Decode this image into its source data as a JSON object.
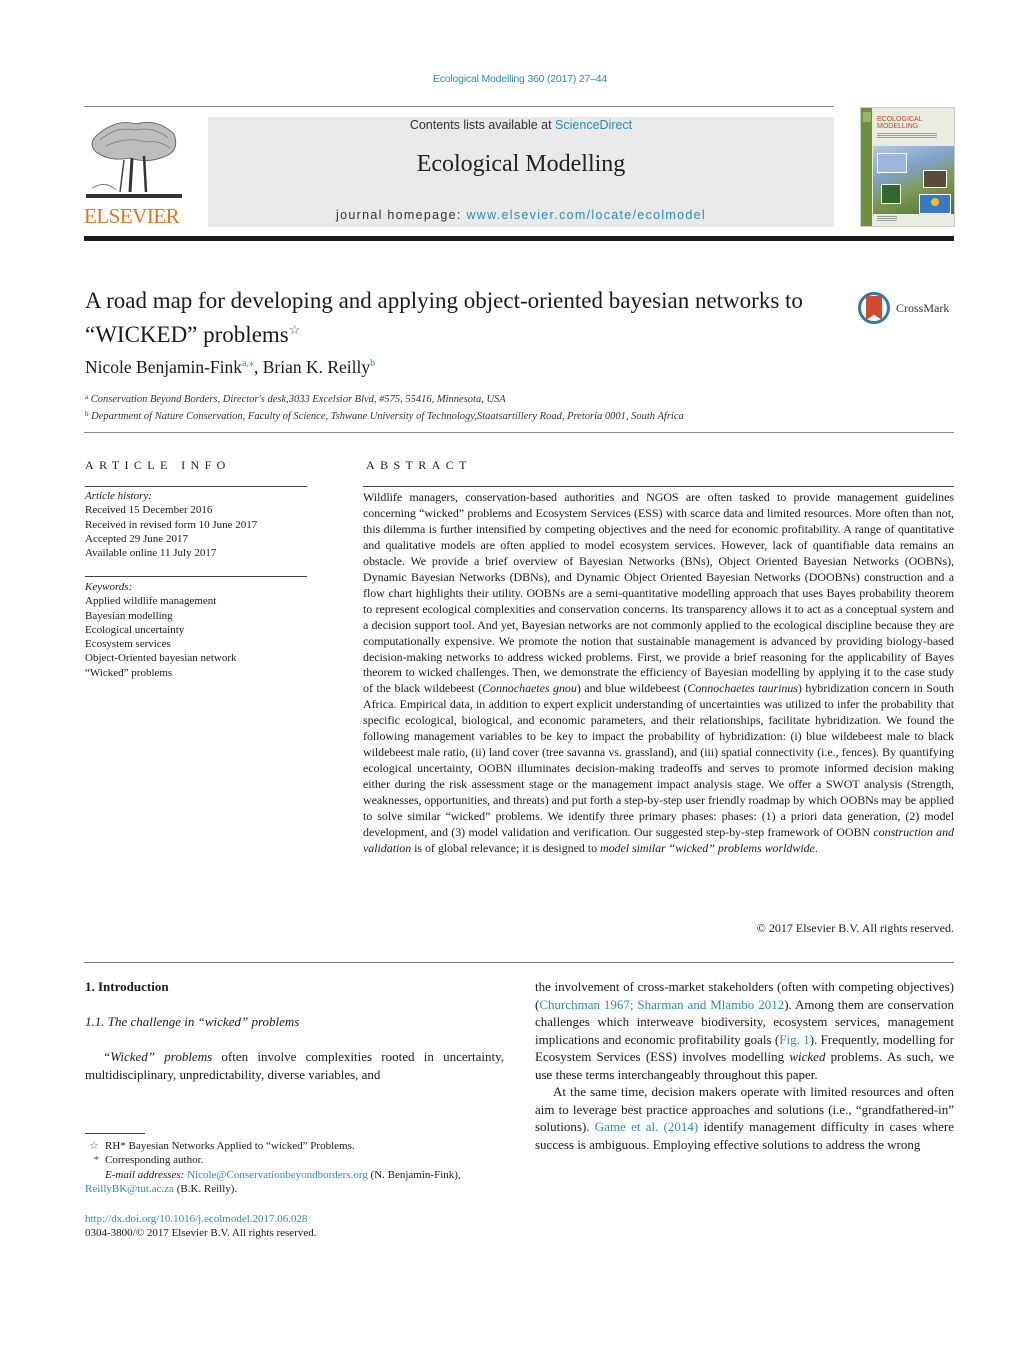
{
  "journal_citation": "Ecological Modelling 360 (2017) 27–44",
  "header": {
    "publisher_wordmark": "ELSEVIER",
    "contents_prefix": "Contents lists available at ",
    "contents_link": "ScienceDirect",
    "journal_name": "Ecological Modelling",
    "homepage_prefix": "journal homepage: ",
    "homepage_link": "www.elsevier.com/locate/ecolmodel",
    "cover": {
      "title_line1": "ECOLOGICAL",
      "title_line2": "MODELLING"
    }
  },
  "article": {
    "title": "A road map for developing and applying object-oriented bayesian networks to “WICKED” problems",
    "title_mark": "☆",
    "crossmark_label": "CrossMark",
    "authors": [
      {
        "name": "Nicole Benjamin-Fink",
        "sup": "a,⁎"
      },
      {
        "name": "Brian K. Reilly",
        "sup": "b"
      }
    ],
    "author_separator": ", ",
    "affiliations": [
      {
        "mark": "a",
        "text": "Conservation Beyond Borders, Director's desk,3033 Excelsior Blvd, #575, 55416, Minnesota, USA"
      },
      {
        "mark": "b",
        "text": "Department of Nature Conservation, Faculty of Science, Tshwane University of Technology,Staatsartillery Road, Pretoria 0001, South Africa"
      }
    ]
  },
  "article_info": {
    "heading": "ARTICLE INFO",
    "history_label": "Article history:",
    "history": [
      "Received 15 December 2016",
      "Received in revised form 10 June 2017",
      "Accepted 29 June 2017",
      "Available online 11 July 2017"
    ],
    "keywords_label": "Keywords:",
    "keywords": [
      "Applied wildlife management",
      "Bayesian modelling",
      "Ecological uncertainty",
      "Ecosystem services",
      "Object-Oriented bayesian network",
      "“Wicked” problems"
    ]
  },
  "abstract": {
    "heading": "ABSTRACT",
    "part1": "Wildlife managers, conservation-based authorities and NGOS are often tasked to provide management guidelines concerning “wicked” problems and Ecosystem Services (ESS) with scarce data and limited resources. More often than not, this dilemma is further intensified by competing objectives and the need for economic profitability. A range of quantitative and qualitative models are often applied to model ecosystem services. However, lack of quantifiable data remains an obstacle. We provide a brief overview of Bayesian Networks (BNs), Object Oriented Bayesian Networks (OOBNs), Dynamic Bayesian Networks (DBNs), and Dynamic Object Oriented Bayesian Networks (DOOBNs) construction and a flow chart highlights their utility. OOBNs are a semi-quantitative modelling approach that uses Bayes probability theorem to represent ecological complexities and conservation concerns. Its transparency allows it to act as a conceptual system and a decision support tool. And yet, Bayesian networks are not commonly applied to the ecological discipline because they are computationally expensive. We promote the notion that sustainable management is advanced by providing biology-based decision-making networks to address wicked problems. First, we provide a brief reasoning for the applicability of Bayes theorem to wicked challenges. Then, we demonstrate the efficiency of Bayesian modelling by applying it to the case study of the black wildebeest (",
    "species1": "Connochaetes gnou",
    "part2": ") and blue wildebeest (",
    "species2": "Connochaetes taurinus",
    "part3": ") hybridization concern in South Africa. Empirical data, in addition to expert explicit understanding of uncertainties was utilized to infer the probability that specific ecological, biological, and economic parameters, and their relationships, facilitate hybridization. We found the following management variables to be key to impact the probability of hybridization: (i) blue wildebeest male to black wildebeest male ratio, (ii) land cover (tree savanna vs. grassland), and (iii) spatial connectivity (i.e., fences). By quantifying ecological uncertainty, OOBN illuminates decision-making tradeoffs and serves to promote informed decision making either during the risk assessment stage or the management impact analysis stage. We offer a SWOT analysis (Strength, weaknesses, opportunities, and threats) and put forth a step-by-step user friendly roadmap by which OOBNs may be applied to solve similar “wicked” problems. We identify three primary phases: phases: (1) a priori data generation, (2) model development, and (3) model validation and verification. Our suggested step-by-step framework of OOBN ",
    "emph1": "construction and validation",
    "part4": " is of global relevance; it is designed to ",
    "emph2": "model similar “wicked” problems worldwide",
    "part5": ".",
    "copyright": "© 2017 Elsevier B.V. All rights reserved."
  },
  "body": {
    "section_heading": "1.  Introduction",
    "subsection_heading": "1.1.  The challenge in “wicked” problems",
    "col1_emph": "“Wicked” problems",
    "col1_text": " often involve complexities rooted in uncertainty, multidisciplinary, unpredictability, diverse variables, and",
    "col2_p1_a": "the involvement of cross-market stakeholders (often with competing objectives) (",
    "col2_cite1": "Churchman 1967; Sharman and Mlambo 2012",
    "col2_p1_b": "). Among them are conservation challenges which interweave biodiversity, ecosystem services, management implications and economic profitability goals (",
    "col2_fig": "Fig. 1",
    "col2_p1_c": "). Frequently, modelling for Ecosystem Services (ESS) involves modelling ",
    "col2_p1_emph": "wicked",
    "col2_p1_d": " problems. As such, we use these terms interchangeably throughout this paper.",
    "col2_p2_a": "At the same time, decision makers operate with limited resources and often aim to leverage best practice approaches and solutions (i.e., “grandfathered-in” solutions). ",
    "col2_cite2": "Game et al. (2014)",
    "col2_p2_b": " identify management difficulty in cases where success is ambiguous. Employing effective solutions to address the wrong"
  },
  "footnotes": {
    "star_mark": "☆",
    "star_text": "RH* Bayesian Networks Applied to “wicked” Problems.",
    "corr_mark": "*",
    "corr_text": "Corresponding author.",
    "email_label": "E-mail addresses:",
    "email1": "Nicole@Conservationbeyondborders.org",
    "email1_owner": " (N. Benjamin-Fink),",
    "email2": "ReillyBK@tut.ac.za",
    "email2_owner": " (B.K. Reilly).",
    "doi_link": "http://dx.doi.org/10.1016/j.ecolmodel.2017.06.028",
    "issn_line": "0304-3800/© 2017 Elsevier B.V. All rights reserved."
  },
  "colors": {
    "link": "#2a8cb8",
    "elsevier_orange": "#e8731a",
    "journal_box_bg": "#e9e9e9",
    "crossmark_red": "#d24b31",
    "crossmark_blue": "#2f7ba8"
  }
}
